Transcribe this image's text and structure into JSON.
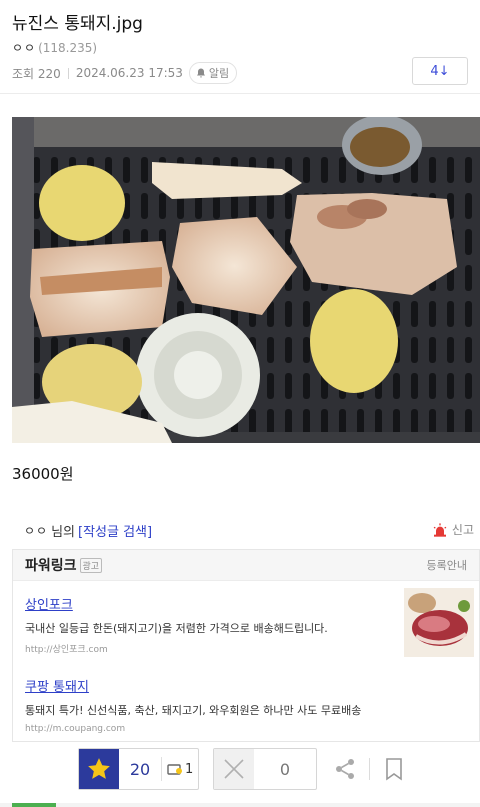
{
  "post": {
    "title": "뉴진스 통돼지.jpg",
    "author_nick": "ㅇㅇ",
    "author_ip": "(118.235)",
    "views_label": "조회 220",
    "datetime": "2024.06.23 17:53",
    "alarm_label": "알림",
    "comment_count": "4↓"
  },
  "content": {
    "price_text": "36000원"
  },
  "author_box": {
    "nick": "ㅇㅇ",
    "suffix": "님의",
    "search_link": "[작성글 검색]",
    "report_label": "신고"
  },
  "powerlink": {
    "title": "파워링크",
    "ad_badge": "광고",
    "register_guide": "등록안내",
    "ads": [
      {
        "title": "상인포크",
        "desc": "국내산 일등급 한돈(돼지고기)을 저렴한 가격으로 배송해드립니다.",
        "url": "http://상인포크.com"
      },
      {
        "title": "쿠팡 통돼지",
        "desc": "통돼지 특가! 신선식품, 축산, 돼지고기, 와우회원은 하나만 사도 무료배송",
        "url": "http://m.coupang.com"
      }
    ]
  },
  "actions": {
    "recommend_count": "20",
    "fixed_recommend_count": "1",
    "dislike_count": "0"
  },
  "colors": {
    "accent_blue": "#2c3a9c",
    "link_blue": "#2e40c8",
    "star_yellow": "#f5c518",
    "report_red": "#e53935"
  },
  "icons": [
    "bell-icon",
    "siren-icon",
    "star-icon",
    "fixed-recommend-icon",
    "close-x-icon",
    "share-icon",
    "bookmark-icon"
  ]
}
